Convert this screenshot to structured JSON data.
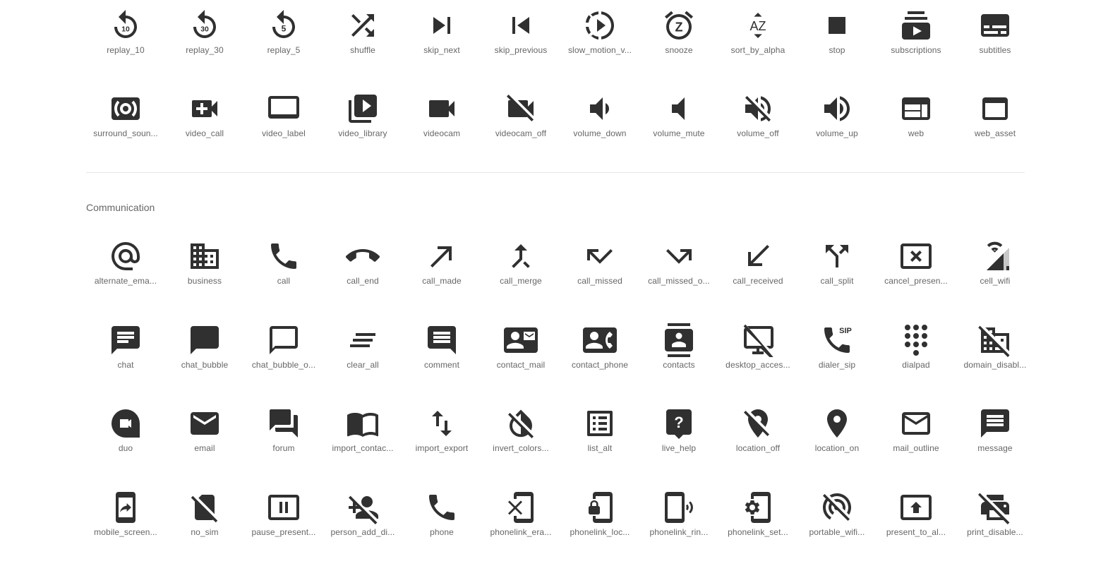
{
  "top_rows": [
    [
      {
        "name": "replay_10",
        "icon": "replay-10-icon",
        "num": "10"
      },
      {
        "name": "replay_30",
        "icon": "replay-30-icon",
        "num": "30"
      },
      {
        "name": "replay_5",
        "icon": "replay-5-icon",
        "num": "5"
      },
      {
        "name": "shuffle",
        "icon": "shuffle-icon"
      },
      {
        "name": "skip_next",
        "icon": "skip-next-icon"
      },
      {
        "name": "skip_previous",
        "icon": "skip-previous-icon"
      },
      {
        "name": "slow_motion_v...",
        "icon": "slow-motion-video-icon"
      },
      {
        "name": "snooze",
        "icon": "snooze-icon",
        "num": "Z"
      },
      {
        "name": "sort_by_alpha",
        "icon": "sort-by-alpha-icon",
        "num": "AZ"
      },
      {
        "name": "stop",
        "icon": "stop-icon"
      },
      {
        "name": "subscriptions",
        "icon": "subscriptions-icon"
      },
      {
        "name": "subtitles",
        "icon": "subtitles-icon"
      }
    ],
    [
      {
        "name": "surround_soun...",
        "icon": "surround-sound-icon"
      },
      {
        "name": "video_call",
        "icon": "video-call-icon"
      },
      {
        "name": "video_label",
        "icon": "video-label-icon"
      },
      {
        "name": "video_library",
        "icon": "video-library-icon"
      },
      {
        "name": "videocam",
        "icon": "videocam-icon"
      },
      {
        "name": "videocam_off",
        "icon": "videocam-off-icon"
      },
      {
        "name": "volume_down",
        "icon": "volume-down-icon"
      },
      {
        "name": "volume_mute",
        "icon": "volume-mute-icon"
      },
      {
        "name": "volume_off",
        "icon": "volume-off-icon"
      },
      {
        "name": "volume_up",
        "icon": "volume-up-icon"
      },
      {
        "name": "web",
        "icon": "web-icon"
      },
      {
        "name": "web_asset",
        "icon": "web-asset-icon"
      }
    ]
  ],
  "section": {
    "title": "Communication",
    "rows": [
      [
        {
          "name": "alternate_ema...",
          "icon": "alternate-email-icon"
        },
        {
          "name": "business",
          "icon": "business-icon"
        },
        {
          "name": "call",
          "icon": "call-icon"
        },
        {
          "name": "call_end",
          "icon": "call-end-icon"
        },
        {
          "name": "call_made",
          "icon": "call-made-icon"
        },
        {
          "name": "call_merge",
          "icon": "call-merge-icon"
        },
        {
          "name": "call_missed",
          "icon": "call-missed-icon"
        },
        {
          "name": "call_missed_o...",
          "icon": "call-missed-outgoing-icon"
        },
        {
          "name": "call_received",
          "icon": "call-received-icon"
        },
        {
          "name": "call_split",
          "icon": "call-split-icon"
        },
        {
          "name": "cancel_presen...",
          "icon": "cancel-presentation-icon"
        },
        {
          "name": "cell_wifi",
          "icon": "cell-wifi-icon"
        }
      ],
      [
        {
          "name": "chat",
          "icon": "chat-icon"
        },
        {
          "name": "chat_bubble",
          "icon": "chat-bubble-icon"
        },
        {
          "name": "chat_bubble_o...",
          "icon": "chat-bubble-outline-icon"
        },
        {
          "name": "clear_all",
          "icon": "clear-all-icon"
        },
        {
          "name": "comment",
          "icon": "comment-icon"
        },
        {
          "name": "contact_mail",
          "icon": "contact-mail-icon"
        },
        {
          "name": "contact_phone",
          "icon": "contact-phone-icon"
        },
        {
          "name": "contacts",
          "icon": "contacts-icon"
        },
        {
          "name": "desktop_acces...",
          "icon": "desktop-access-disabled-icon"
        },
        {
          "name": "dialer_sip",
          "icon": "dialer-sip-icon",
          "num": "SIP"
        },
        {
          "name": "dialpad",
          "icon": "dialpad-icon"
        },
        {
          "name": "domain_disabl...",
          "icon": "domain-disabled-icon"
        }
      ],
      [
        {
          "name": "duo",
          "icon": "duo-icon"
        },
        {
          "name": "email",
          "icon": "email-icon"
        },
        {
          "name": "forum",
          "icon": "forum-icon"
        },
        {
          "name": "import_contac...",
          "icon": "import-contacts-icon"
        },
        {
          "name": "import_export",
          "icon": "import-export-icon"
        },
        {
          "name": "invert_colors...",
          "icon": "invert-colors-off-icon"
        },
        {
          "name": "list_alt",
          "icon": "list-alt-icon"
        },
        {
          "name": "live_help",
          "icon": "live-help-icon",
          "num": "?"
        },
        {
          "name": "location_off",
          "icon": "location-off-icon"
        },
        {
          "name": "location_on",
          "icon": "location-on-icon"
        },
        {
          "name": "mail_outline",
          "icon": "mail-outline-icon"
        },
        {
          "name": "message",
          "icon": "message-icon"
        }
      ],
      [
        {
          "name": "mobile_screen...",
          "icon": "mobile-screen-share-icon"
        },
        {
          "name": "no_sim",
          "icon": "no-sim-icon"
        },
        {
          "name": "pause_present...",
          "icon": "pause-presentation-icon"
        },
        {
          "name": "person_add_di...",
          "icon": "person-add-disabled-icon"
        },
        {
          "name": "phone",
          "icon": "phone-icon"
        },
        {
          "name": "phonelink_era...",
          "icon": "phonelink-erase-icon"
        },
        {
          "name": "phonelink_loc...",
          "icon": "phonelink-lock-icon"
        },
        {
          "name": "phonelink_rin...",
          "icon": "phonelink-ring-icon"
        },
        {
          "name": "phonelink_set...",
          "icon": "phonelink-setup-icon"
        },
        {
          "name": "portable_wifi...",
          "icon": "portable-wifi-off-icon"
        },
        {
          "name": "present_to_al...",
          "icon": "present-to-all-icon"
        },
        {
          "name": "print_disable...",
          "icon": "print-disabled-icon"
        }
      ]
    ]
  }
}
